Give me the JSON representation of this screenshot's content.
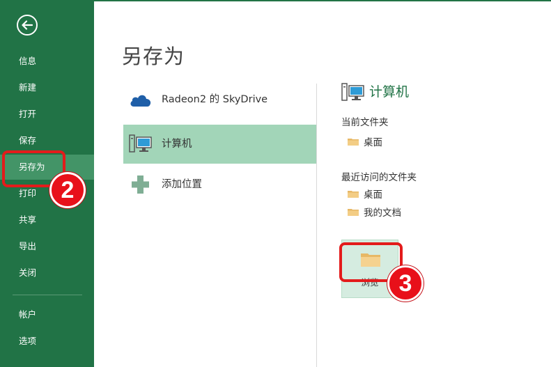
{
  "sidebar": {
    "items": [
      {
        "label": "信息"
      },
      {
        "label": "新建"
      },
      {
        "label": "打开"
      },
      {
        "label": "保存"
      },
      {
        "label": "另存为",
        "active": true
      },
      {
        "label": "打印"
      },
      {
        "label": "共享"
      },
      {
        "label": "导出"
      },
      {
        "label": "关闭"
      },
      {
        "label": "帐户"
      },
      {
        "label": "选项"
      }
    ]
  },
  "main": {
    "title": "另存为",
    "places": [
      {
        "label": "Radeon2 的 SkyDrive",
        "icon": "cloud-icon"
      },
      {
        "label": "计算机",
        "icon": "computer-icon",
        "selected": true
      },
      {
        "label": "添加位置",
        "icon": "plus-icon"
      }
    ]
  },
  "right_panel": {
    "header": "计算机",
    "current_folder_label": "当前文件夹",
    "current_folders": [
      "桌面"
    ],
    "recent_label": "最近访问的文件夹",
    "recent_folders": [
      "桌面",
      "我的文档"
    ],
    "browse_label": "浏览"
  },
  "annotations": {
    "step2": "2",
    "step3": "3"
  },
  "colors": {
    "brand_green": "#217346",
    "selected_green": "#a2d5b8",
    "annotation_red": "#e31b1b"
  }
}
